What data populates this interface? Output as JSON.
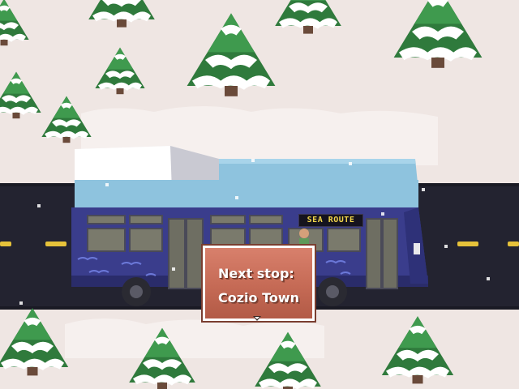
{
  "dialog": {
    "line1": "Next stop:",
    "line2": "Cozio Town"
  },
  "bus": {
    "destination_sign": "SEA ROUTE"
  },
  "colors": {
    "snow": "#efe6e3",
    "road": "#232330",
    "road_marking": "#e6c23a",
    "bus_body": "#3a3d8c",
    "bus_roof": "#8ec3de",
    "dialog_fill": "#c56a55",
    "tree_green": "#2f7a3c"
  },
  "icons": {
    "advance": "advance-arrow-icon"
  }
}
